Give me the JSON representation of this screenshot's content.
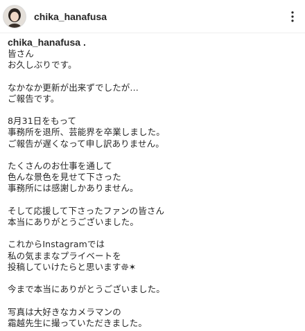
{
  "post": {
    "username": "chika_hanafusa",
    "more_icon": "more-vertical-icon",
    "avatar_icon": "profile-photo-avatar"
  },
  "caption": {
    "username": "chika_hanafusa .",
    "body": "皆さん\nお久しぶりです。\n\nなかなか更新が出来ずでしたが…\nご報告です。\n\n8月31日をもって\n事務所を退所、芸能界を卒業しました。\nご報告が遅くなって申し訳ありません。\n\nたくさんのお仕事を通して\n色んな景色を見せて下さった\n事務所には感謝しかありません。\n\nそして応援して下さったファンの皆さん\n本当にありがとうございました。\n\nこれからInstagramでは\n私の気ままなプライベートを\n投稿していけたらと思います𐩕✶\n\n今まで本当にありがとうございました。\n\n写真は大好きなカメラマンの\n霜越先生に撮っていただきました。"
  }
}
